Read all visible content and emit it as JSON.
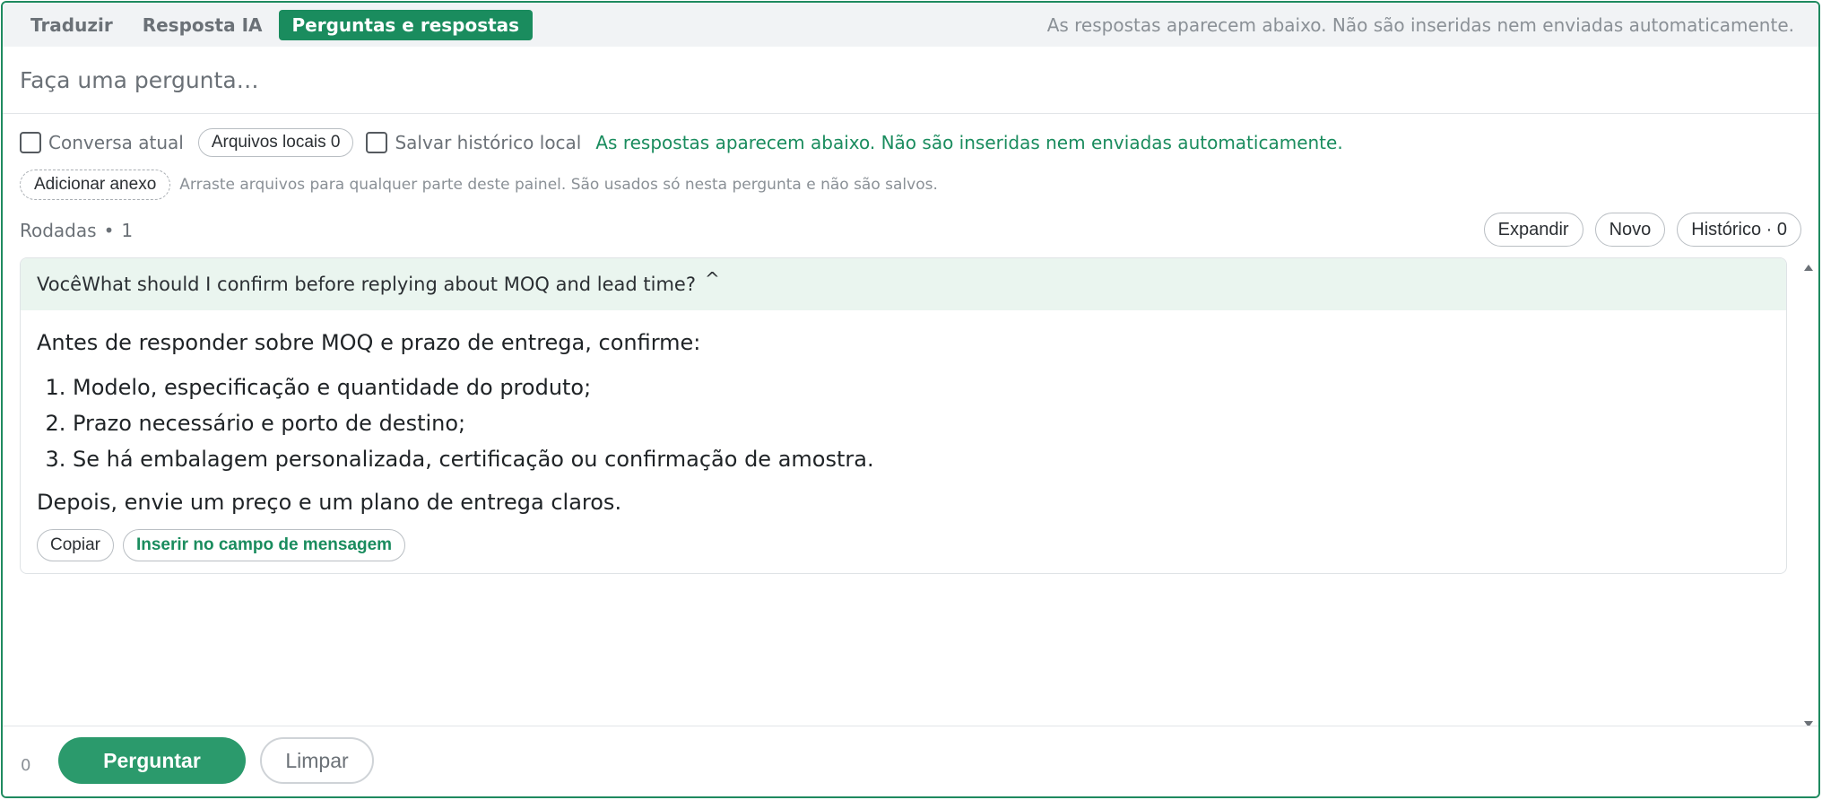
{
  "tabs": [
    {
      "label": "Traduzir",
      "active": false
    },
    {
      "label": "Resposta IA",
      "active": false
    },
    {
      "label": "Perguntas e respostas",
      "active": true
    }
  ],
  "header_hint": "As respostas aparecem abaixo. Não são inseridas nem enviadas automaticamente.",
  "question": {
    "placeholder": "Faça uma pergunta…",
    "value": ""
  },
  "options": {
    "current_conversation_label": "Conversa atual",
    "local_files_label": "Arquivos locais 0",
    "save_history_label": "Salvar histórico local",
    "note": "As respostas aparecem abaixo. Não são inseridas nem enviadas automaticamente."
  },
  "attach": {
    "button_label": "Adicionar anexo",
    "hint": "Arraste arquivos para qualquer parte deste painel. São usados só nesta pergunta e não são salvos."
  },
  "rounds": {
    "label": "Rodadas",
    "separator": "•",
    "count": "1"
  },
  "actions": {
    "expand": "Expandir",
    "new": "Novo",
    "history": "Histórico · 0"
  },
  "conversation": {
    "you_label": "Você",
    "question": "What should I confirm before replying about MOQ and lead time?",
    "caret": "^",
    "answer_intro": "Antes de responder sobre MOQ e prazo de entrega, confirme:",
    "answer_items": [
      "Modelo, especificação e quantidade do produto;",
      "Prazo necessário e porto de destino;",
      "Se há embalagem personalizada, certificação ou confirmação de amostra."
    ],
    "answer_outro": "Depois, envie um preço e um plano de entrega claros.",
    "copy_label": "Copiar",
    "insert_label": "Inserir no campo de mensagem"
  },
  "footer": {
    "count": "0",
    "ask_label": "Perguntar",
    "clear_label": "Limpar"
  },
  "colors": {
    "accent": "#1a8c5e",
    "button": "#2b9a6c",
    "muted": "#6b7177"
  }
}
